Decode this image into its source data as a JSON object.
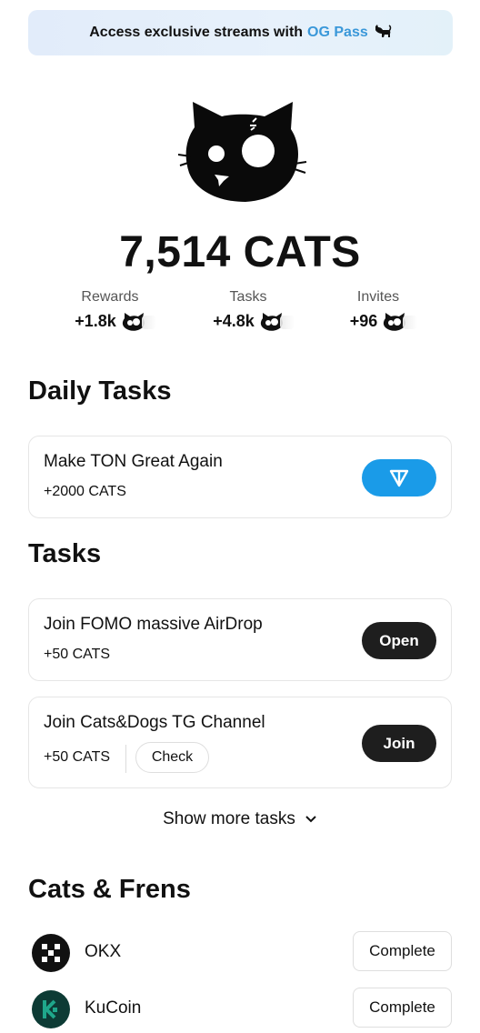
{
  "banner": {
    "text": "Access exclusive streams with",
    "link": "OG Pass",
    "icon": "black-cat-icon"
  },
  "hero": {
    "icon": "cat-logo-icon"
  },
  "balance": "7,514 CATS",
  "stats": [
    {
      "label": "Rewards",
      "value": "+1.8k"
    },
    {
      "label": "Tasks",
      "value": "+4.8k"
    },
    {
      "label": "Invites",
      "value": "+96"
    }
  ],
  "daily": {
    "title": "Daily Tasks",
    "task": {
      "title": "Make TON Great Again",
      "reward": "+2000 CATS",
      "button_icon": "ton-icon"
    }
  },
  "tasks": {
    "title": "Tasks",
    "items": [
      {
        "title": "Join FOMO massive AirDrop",
        "reward": "+50 CATS",
        "button": "Open"
      },
      {
        "title": "Join Cats&Dogs TG Channel",
        "reward": "+50 CATS",
        "secondary": "Check",
        "button": "Join"
      }
    ],
    "show_more": "Show more tasks"
  },
  "frens": {
    "title": "Cats & Frens",
    "items": [
      {
        "name": "OKX",
        "button": "Complete",
        "icon": "okx-logo-icon"
      },
      {
        "name": "KuCoin",
        "button": "Complete",
        "icon": "kucoin-logo-icon"
      }
    ]
  },
  "colors": {
    "accent": "#1a9be8",
    "link": "#3a98d9",
    "dark_button": "#1e1e1e",
    "kucoin": "#1fa78b"
  }
}
